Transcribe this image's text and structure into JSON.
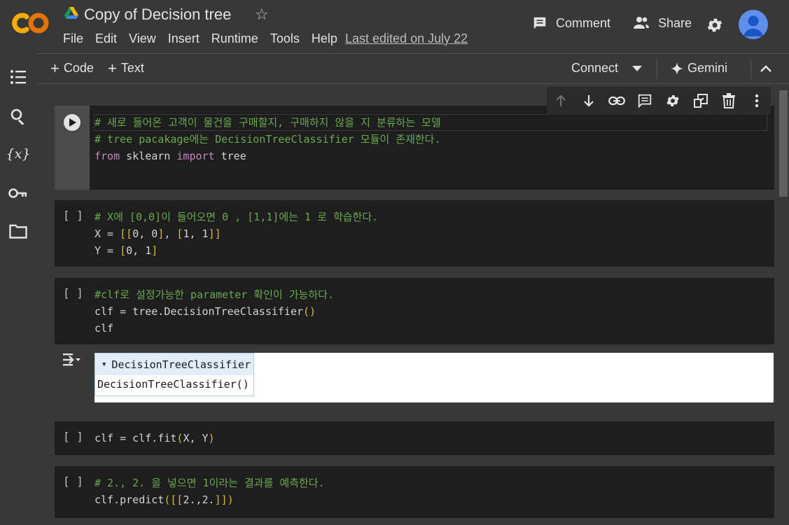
{
  "header": {
    "logo": "CO",
    "title": "Copy of Decision tree",
    "menu": [
      "File",
      "Edit",
      "View",
      "Insert",
      "Runtime",
      "Tools",
      "Help"
    ],
    "last_edited": "Last edited on July 22",
    "comment_label": "Comment",
    "share_label": "Share"
  },
  "toolbar": {
    "code_label": "Code",
    "text_label": "Text",
    "connect_label": "Connect",
    "gemini_label": "Gemini"
  },
  "cells": [
    {
      "bracket": "",
      "lines": [
        [
          {
            "t": "# 새로 들어온 고객이 물건을 구매할지, 구매하지 않을 지 분류하는 모델",
            "c": "comment"
          }
        ],
        [
          {
            "t": "# tree pacakage에는 DecisionTreeClassifier 모듈이 존재한다.",
            "c": "comment"
          }
        ],
        [
          {
            "t": "from",
            "c": "kw"
          },
          {
            "t": " sklearn ",
            "c": ""
          },
          {
            "t": "import",
            "c": "kw"
          },
          {
            "t": " tree",
            "c": ""
          }
        ]
      ]
    },
    {
      "bracket": "[ ]",
      "lines": [
        [
          {
            "t": "# X에 [0,0]이 들어오면 0 , [1,1]에는 1 로 학습한다.",
            "c": "comment"
          }
        ],
        [
          {
            "t": "X = ",
            "c": ""
          },
          {
            "t": "[[",
            "c": "br"
          },
          {
            "t": "0, 0",
            "c": ""
          },
          {
            "t": "]",
            "c": "br"
          },
          {
            "t": ", ",
            "c": ""
          },
          {
            "t": "[",
            "c": "br"
          },
          {
            "t": "1, 1",
            "c": ""
          },
          {
            "t": "]]",
            "c": "br"
          }
        ],
        [
          {
            "t": "Y = ",
            "c": ""
          },
          {
            "t": "[",
            "c": "br"
          },
          {
            "t": "0, 1",
            "c": ""
          },
          {
            "t": "]",
            "c": "br"
          }
        ]
      ]
    },
    {
      "bracket": "[ ]",
      "lines": [
        [
          {
            "t": "#clf로 설정가능한 parameter 확인이 가능하다.",
            "c": "comment"
          }
        ],
        [
          {
            "t": "clf = tree.DecisionTreeClassifier",
            "c": ""
          },
          {
            "t": "()",
            "c": "br"
          }
        ],
        [
          {
            "t": "clf",
            "c": ""
          }
        ]
      ],
      "output": {
        "estimator_name": "DecisionTreeClassifier",
        "estimator_repr": "DecisionTreeClassifier()"
      }
    },
    {
      "bracket": "[ ]",
      "lines": [
        [
          {
            "t": "clf = clf.fit",
            "c": ""
          },
          {
            "t": "(",
            "c": "br"
          },
          {
            "t": "X, Y",
            "c": ""
          },
          {
            "t": ")",
            "c": "br"
          }
        ]
      ]
    },
    {
      "bracket": "[ ]",
      "lines": [
        [
          {
            "t": "# 2., 2. 을 넣으면 1이라는 결과를 예측한다.",
            "c": "comment"
          }
        ],
        [
          {
            "t": "clf.predict",
            "c": ""
          },
          {
            "t": "([[",
            "c": "br"
          },
          {
            "t": "2.,2.",
            "c": ""
          },
          {
            "t": "]])",
            "c": "br"
          }
        ]
      ]
    }
  ],
  "colors": {
    "background": "#383838",
    "cell_bg": "#1e1e1e",
    "comment": "#6aa84f",
    "keyword": "#c586c0",
    "bracket": "#d7ba3d",
    "logo_orange": "#f9ab00"
  }
}
